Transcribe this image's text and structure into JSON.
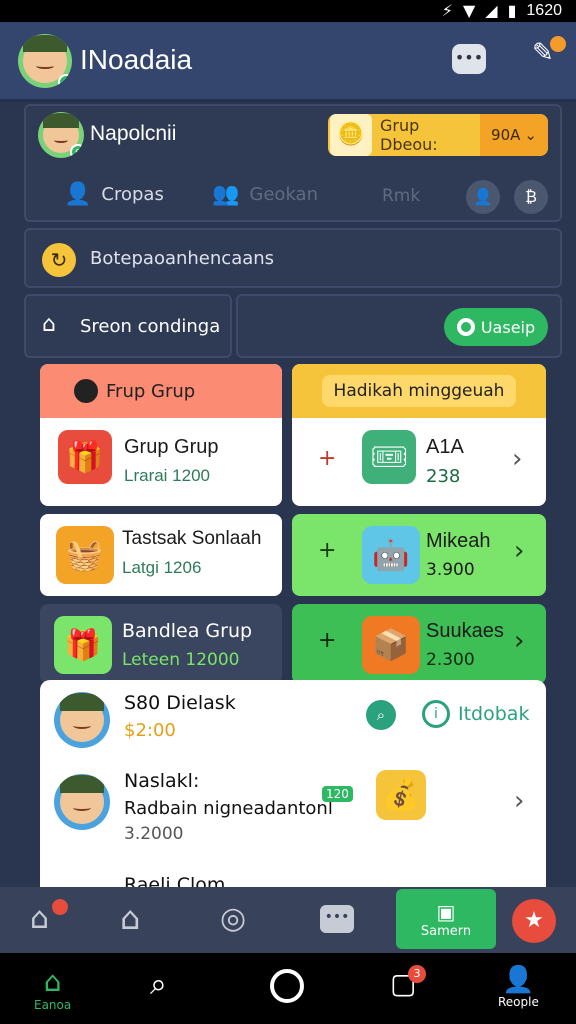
{
  "status_bar": {
    "signal_icon": "signal-icon",
    "wifi_icon": "wifi-icon",
    "battery_icon": "battery-icon",
    "time": "1620"
  },
  "app_bar": {
    "title": "INoadaia"
  },
  "profile": {
    "name": "Napolcnii",
    "group_button_label": "Grup Dbeou:",
    "group_value": "90A"
  },
  "tabs": [
    {
      "label": "Cropas"
    },
    {
      "label": "Geokan"
    },
    {
      "label": "Rmk"
    }
  ],
  "banner": {
    "label": "Botepaoanhencaans"
  },
  "section": {
    "label": "Sreon condinga",
    "button_label": "Uaseip"
  },
  "cards": {
    "left_header": "Frup Grup",
    "right_header": "Hadikah minggeuah",
    "grup": {
      "title": "Grup Grup",
      "sub": "Lrarai 1200"
    },
    "right1": {
      "title": "A1A",
      "sub": "238"
    },
    "tastsak": {
      "title": "Tastsak Sonlaah",
      "sub": "Latgi 1206"
    },
    "mikeah": {
      "title": "Mikeah",
      "sub": "3.900"
    },
    "bandea": {
      "title": "Bandlea Grup",
      "sub": "Leteen 12000"
    },
    "sukaes": {
      "title": "Suukaes",
      "sub": "2.300"
    }
  },
  "list": {
    "item1": {
      "title": "S80 Dielask",
      "sub": "$2:00",
      "link": "Itdobak"
    },
    "item2": {
      "title": "Naslakl:",
      "sub": "Radbain nigneadantonl",
      "sub2": "3.2000",
      "tag": "120"
    },
    "item3": {
      "title": "Raeli Clom"
    }
  },
  "bottom_nav": {
    "highlight_label": "Samern"
  },
  "sys_nav": {
    "home_label": "Eanoa",
    "profile_label": "Reople",
    "docs_badge": "3"
  },
  "colors": {
    "green": "#2eb862",
    "yellow": "#f6c43a",
    "salmon": "#fb8b73",
    "lightgreen": "#7be56b"
  }
}
